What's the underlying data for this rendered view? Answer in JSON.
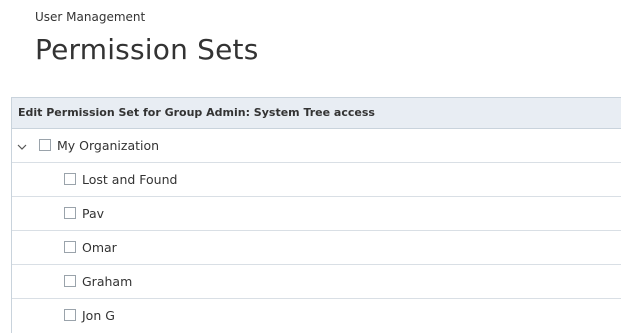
{
  "header": {
    "breadcrumb": "User Management",
    "title": "Permission Sets"
  },
  "panel": {
    "title": "Edit Permission Set for Group Admin: System Tree access"
  },
  "tree": {
    "root": {
      "label": "My Organization",
      "expanded": true,
      "checked": false
    },
    "children": [
      {
        "label": "Lost and Found",
        "checked": false
      },
      {
        "label": "Pav",
        "checked": false
      },
      {
        "label": "Omar",
        "checked": false
      },
      {
        "label": "Graham",
        "checked": false
      },
      {
        "label": "Jon G",
        "checked": false
      }
    ]
  },
  "icons": {
    "expand": "chevron-down-icon"
  },
  "colors": {
    "header_bg": "#e8edf3",
    "border": "#c9d3dc",
    "text": "#333333"
  }
}
